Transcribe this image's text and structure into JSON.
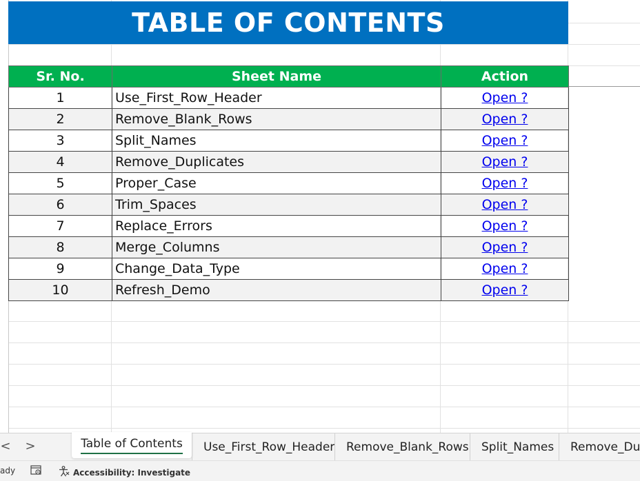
{
  "sheet": {
    "title": "TABLE OF CONTENTS",
    "headers": {
      "sr_no": "Sr. No.",
      "sheet_name": "Sheet Name",
      "action": "Action"
    },
    "rows": [
      {
        "sr": "1",
        "name": "Use_First_Row_Header",
        "action": "Open ?"
      },
      {
        "sr": "2",
        "name": "Remove_Blank_Rows",
        "action": "Open ?"
      },
      {
        "sr": "3",
        "name": "Split_Names",
        "action": "Open ?"
      },
      {
        "sr": "4",
        "name": "Remove_Duplicates",
        "action": "Open ?"
      },
      {
        "sr": "5",
        "name": "Proper_Case",
        "action": "Open ?"
      },
      {
        "sr": "6",
        "name": "Trim_Spaces",
        "action": "Open ?"
      },
      {
        "sr": "7",
        "name": "Replace_Errors",
        "action": "Open ?"
      },
      {
        "sr": "8",
        "name": "Merge_Columns",
        "action": "Open ?"
      },
      {
        "sr": "9",
        "name": "Change_Data_Type",
        "action": "Open ?"
      },
      {
        "sr": "10",
        "name": "Refresh_Demo",
        "action": "Open ?"
      }
    ]
  },
  "tabs": {
    "prev": "<",
    "next": ">",
    "items": [
      "Table of Contents",
      "Use_First_Row_Header",
      "Remove_Blank_Rows",
      "Split_Names",
      "Remove_Dup"
    ]
  },
  "status": {
    "ready": "ady",
    "accessibility": "Accessibility: Investigate"
  },
  "colors": {
    "title_bg": "#0070c0",
    "header_bg": "#00b050",
    "link": "#0000ee",
    "alt_row": "#f2f2f2"
  }
}
